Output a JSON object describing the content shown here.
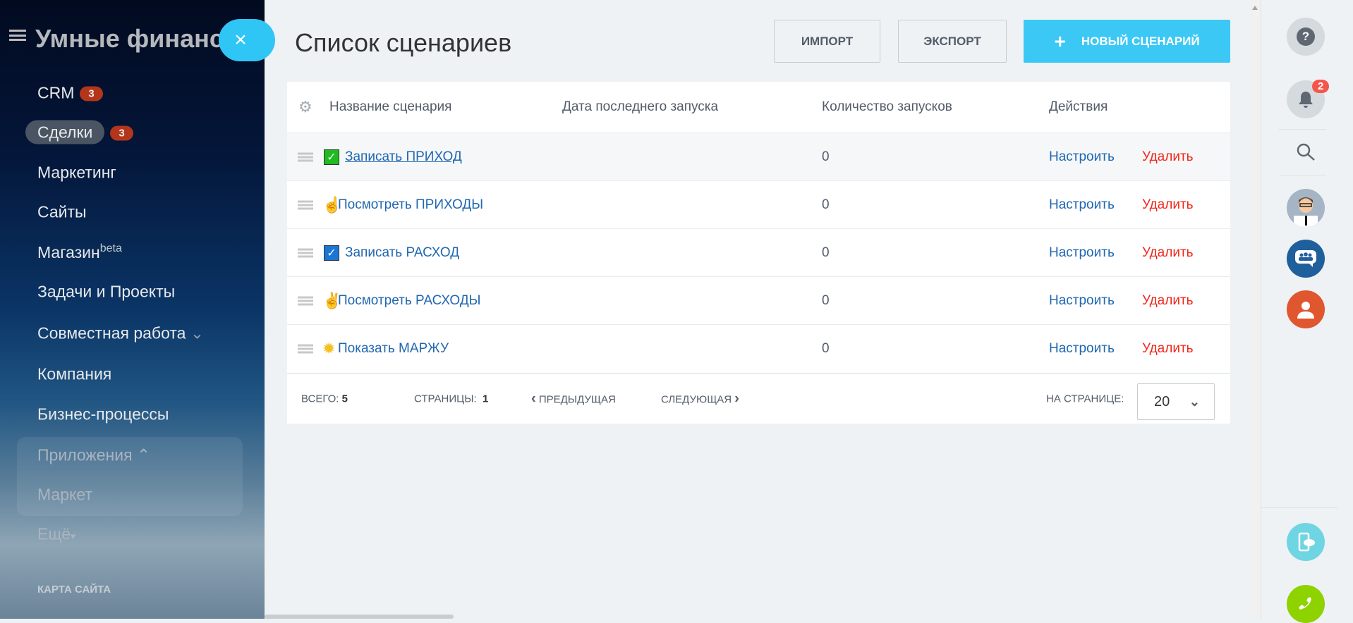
{
  "sidebar": {
    "portal_title": "Умные финансы",
    "items": [
      {
        "label": "CRM",
        "badge": "3"
      },
      {
        "label": "Сделки",
        "badge": "3"
      },
      {
        "label": "Маркетинг"
      },
      {
        "label": "Сайты"
      },
      {
        "label": "Магазин",
        "sup": "beta"
      },
      {
        "label": "Задачи и Проекты"
      },
      {
        "label": "Совместная работа",
        "chevron": "⌄"
      },
      {
        "label": "Компания"
      },
      {
        "label": "Бизнес-процессы"
      },
      {
        "label": "Приложения",
        "chevron": "⌃"
      },
      {
        "label": "Маркет"
      },
      {
        "label": "Ещё",
        "chevron": "▾"
      }
    ],
    "sitemap_label": "КАРТА САЙТА",
    "close_icon": "×"
  },
  "header": {
    "title": "Список сценариев",
    "import_label": "ИМПОРТ",
    "export_label": "ЭКСПОРТ",
    "new_label": "НОВЫЙ СЦЕНАРИЙ",
    "new_icon": "+"
  },
  "table": {
    "columns": [
      "Название сценария",
      "Дата последнего запуска",
      "Количество запусков",
      "Действия"
    ],
    "rows": [
      {
        "icon": "✓",
        "icon_color": "#1fbb1f",
        "name": "Записать ПРИХОД",
        "date": "",
        "count": "0",
        "configure": "Настроить",
        "delete": "Удалить"
      },
      {
        "icon": "☝",
        "icon_color": "#f5c023",
        "name": "Посмотреть ПРИХОДЫ",
        "date": "",
        "count": "0",
        "configure": "Настроить",
        "delete": "Удалить"
      },
      {
        "icon": "✓",
        "icon_color": "#1b76d6",
        "name": "Записать РАСХОД",
        "date": "",
        "count": "0",
        "configure": "Настроить",
        "delete": "Удалить"
      },
      {
        "icon": "✌",
        "icon_color": "#f5c023",
        "name": "Посмотреть РАСХОДЫ",
        "date": "",
        "count": "0",
        "configure": "Настроить",
        "delete": "Удалить"
      },
      {
        "icon": "✹",
        "icon_color": "#f5c023",
        "name": "Показать МАРЖУ",
        "date": "",
        "count": "0",
        "configure": "Настроить",
        "delete": "Удалить"
      }
    ],
    "footer": {
      "total_label": "ВСЕГО:",
      "total": "5",
      "pages_label": "СТРАНИЦЫ:",
      "page": "1",
      "prev": "ПРЕДЫДУЩАЯ",
      "next": "СЛЕДУЮЩАЯ",
      "per_page_label": "НА СТРАНИЦЕ:",
      "per_page": "20"
    }
  },
  "right_panel": {
    "help_icon": "?",
    "notifications_count": "2"
  },
  "colors": {
    "accent": "#3bc8f5",
    "link": "#2067b0",
    "delete": "#f0261a",
    "badge": "#b3361a"
  }
}
